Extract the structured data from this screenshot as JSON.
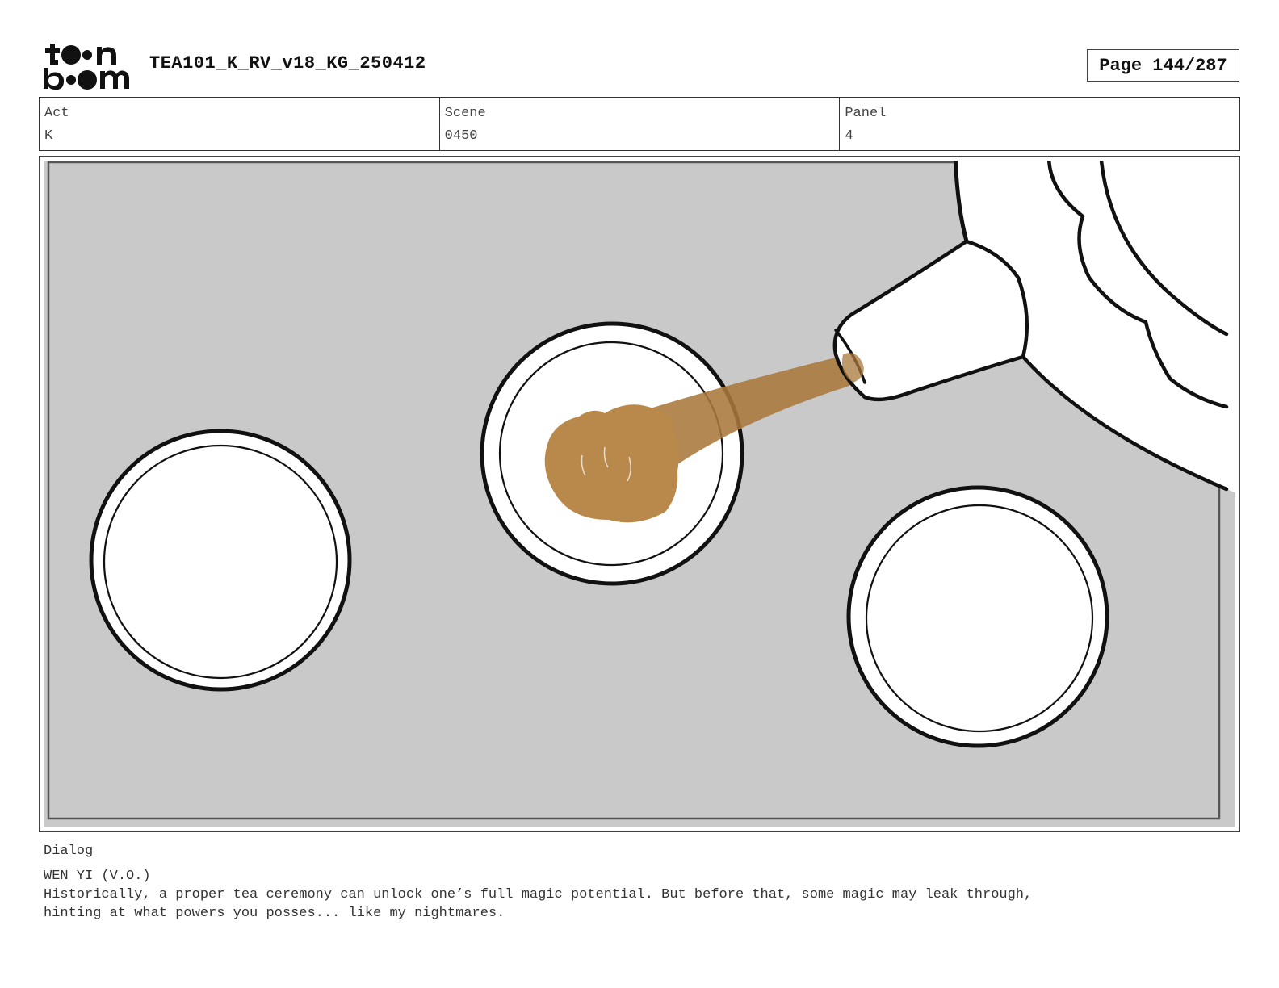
{
  "header": {
    "logo_text": "toon boom",
    "document_title": "TEA101_K_RV_v18_KG_250412",
    "page_label": "Page 144/287"
  },
  "info": {
    "act": {
      "label": "Act",
      "value": "K"
    },
    "scene": {
      "label": "Scene",
      "value": "0450"
    },
    "panel": {
      "label": "Panel",
      "value": "4"
    }
  },
  "artwork": {
    "subject": "teapot pouring tea into center cup, three cups on grey table",
    "background_color": "#c9c9c9",
    "tea_color": "#b58a4a",
    "line_color": "#111111"
  },
  "dialog": {
    "heading": "Dialog",
    "speaker": "WEN YI (V.O.)",
    "lines": [
      "Historically, a proper tea ceremony can unlock one’s full magic potential. But before that, some magic may leak through,",
      "hinting at what powers you posses... like my nightmares."
    ]
  }
}
